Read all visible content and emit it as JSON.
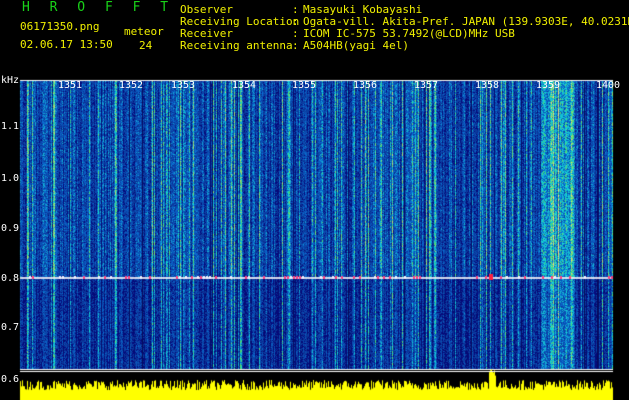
{
  "app": {
    "title": "H R O F F T"
  },
  "header": {
    "file_name": "06171350.png",
    "date_time": "02.06.17 13:50",
    "meteor_label": "meteor",
    "meteor_count": "24",
    "fields": [
      {
        "label": "Observer",
        "value": "Masayuki Kobayashi"
      },
      {
        "label": "Receiving Location",
        "value": "Ogata-vill. Akita-Pref. JAPAN (139.9303E, 40.0231N)"
      },
      {
        "label": "Receiver",
        "value": "ICOM IC-575 53.7492(@LCD)MHz USB"
      },
      {
        "label": "Receiving antenna",
        "value": "A504HB(yagi 4el)"
      }
    ],
    "colon": ":"
  },
  "axes": {
    "y_unit": "kHz",
    "y_ticks": [
      "1.1",
      "1.0",
      "0.9",
      "0.8",
      "0.7",
      "0.6"
    ],
    "x_ticks": [
      "1351",
      "1352",
      "1353",
      "1354",
      "1355",
      "1356",
      "1357",
      "1358",
      "1359",
      "1400"
    ]
  },
  "colors": {
    "background": "#000000",
    "header_text": "#f0f000",
    "title_text": "#19d219",
    "spectrum_base": "#0a1a8c",
    "signal_line": "#e8e8f0",
    "power_trace": "#ffff00"
  }
}
